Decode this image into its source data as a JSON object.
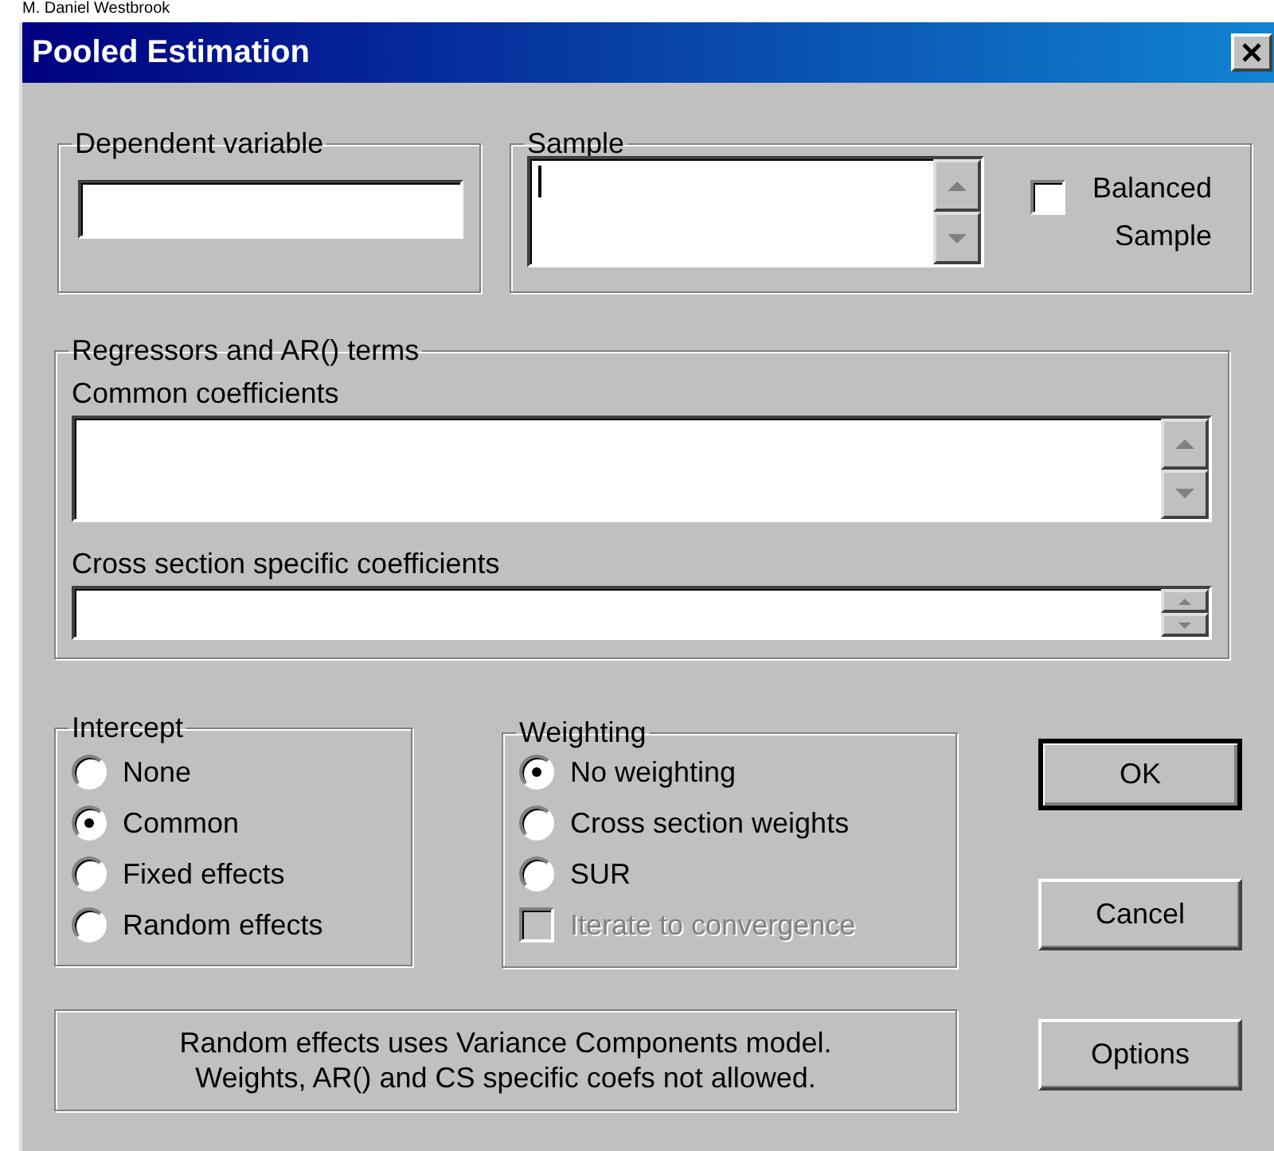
{
  "background_text": "M. Daniel Westbrook",
  "window": {
    "title": "Pooled Estimation"
  },
  "dependent_variable": {
    "label": "Dependent variable"
  },
  "sample": {
    "label": "Sample",
    "balanced": {
      "label": "Balanced Sample",
      "checked": false
    }
  },
  "regressors": {
    "label": "Regressors and AR() terms",
    "common_label": "Common coefficients",
    "cross_section_label": "Cross section specific coefficients"
  },
  "intercept": {
    "label": "Intercept",
    "options": [
      {
        "label": "None",
        "selected": false
      },
      {
        "label": "Common",
        "selected": true
      },
      {
        "label": "Fixed effects",
        "selected": false
      },
      {
        "label": "Random effects",
        "selected": false
      }
    ]
  },
  "weighting": {
    "label": "Weighting",
    "options": [
      {
        "label": "No weighting",
        "selected": true
      },
      {
        "label": "Cross section weights",
        "selected": false
      },
      {
        "label": "SUR",
        "selected": false
      }
    ],
    "iterate": {
      "label": "Iterate to convergence",
      "checked": false,
      "disabled": true
    }
  },
  "note": [
    "Random effects uses Variance Components model.",
    "Weights, AR() and CS specific coefs not allowed."
  ],
  "buttons": [
    {
      "label": "OK",
      "default": true
    },
    {
      "label": "Cancel",
      "default": false
    },
    {
      "label": "Options",
      "default": false
    }
  ]
}
